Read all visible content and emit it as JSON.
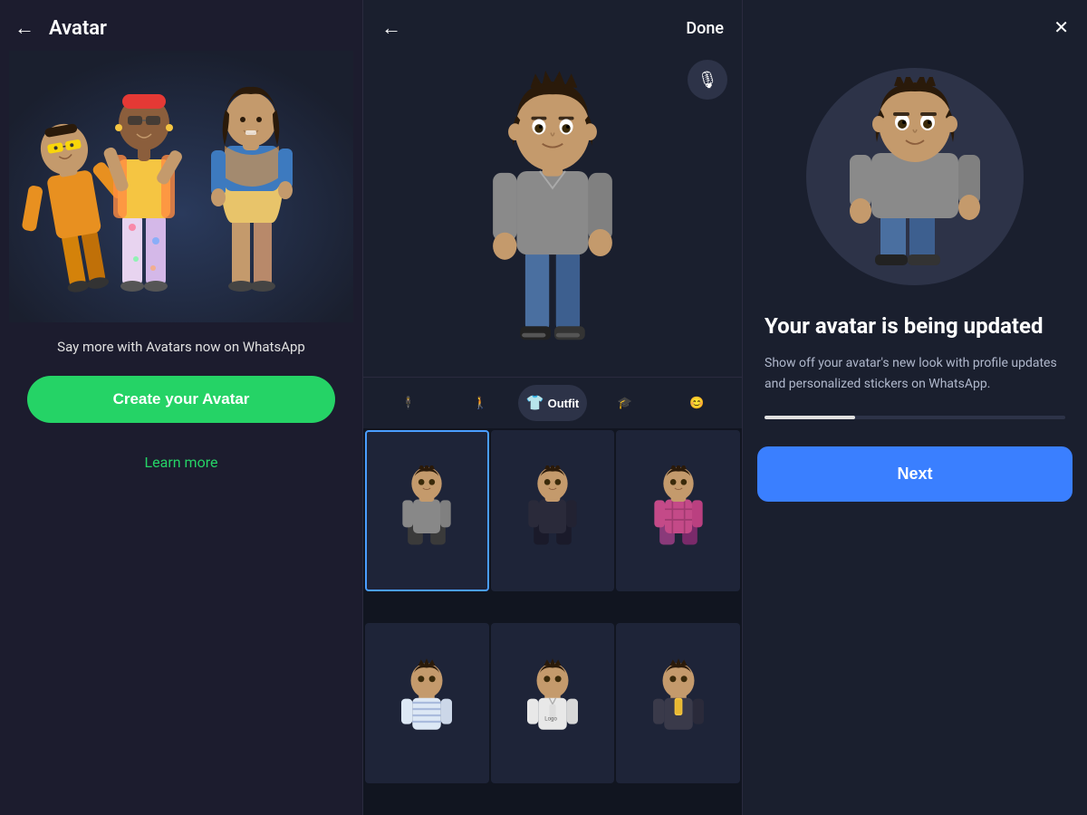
{
  "panel1": {
    "header": {
      "back_label": "←",
      "title": "Avatar"
    },
    "promo_text": "Say more with Avatars now on WhatsApp",
    "create_btn": "Create your Avatar",
    "learn_more": "Learn more"
  },
  "panel2": {
    "header": {
      "back_label": "←",
      "done_label": "Done"
    },
    "mic_icon": "🎙",
    "tabs": [
      {
        "id": "body",
        "icon": "🕴",
        "label": "",
        "active": false
      },
      {
        "id": "figure",
        "icon": "🚶",
        "label": "",
        "active": false
      },
      {
        "id": "outfit",
        "icon": "👕",
        "label": "Outfit",
        "active": true
      },
      {
        "id": "hat",
        "icon": "🎓",
        "label": "",
        "active": false
      },
      {
        "id": "face",
        "icon": "😊",
        "label": "",
        "active": false
      }
    ]
  },
  "panel3": {
    "close_icon": "✕",
    "update_title": "Your avatar is being updated",
    "update_desc": "Show off your avatar's new look with profile updates and personalized stickers on WhatsApp.",
    "next_label": "Next",
    "progress_percent": 30
  }
}
